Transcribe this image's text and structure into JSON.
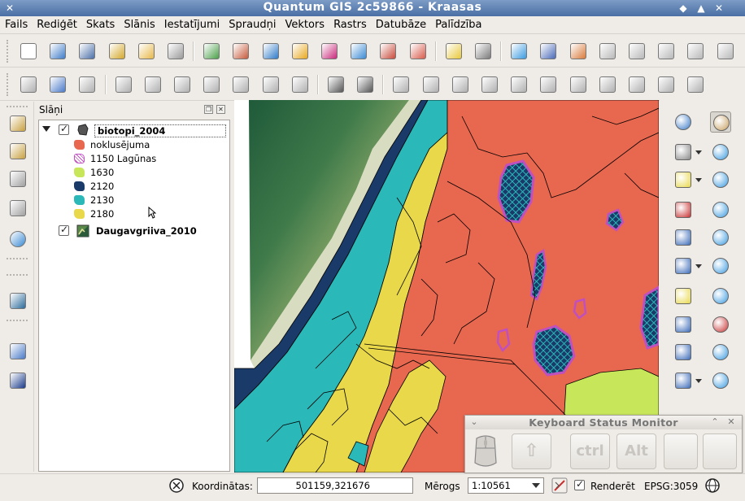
{
  "window": {
    "title": "Quantum GIS 2c59866 - Kraasas",
    "buttons": [
      "◆",
      "▲",
      "✕"
    ]
  },
  "menu": [
    "Fails",
    "Rediģēt",
    "Skats",
    "Slānis",
    "Iestatījumi",
    "Spraudņi",
    "Vektors",
    "Rastrs",
    "Datubāze",
    "Palīdzība"
  ],
  "toolbar1": [
    {
      "name": "new-project-icon",
      "color": "#ffffff"
    },
    {
      "name": "open-project-icon",
      "color": "#3e7cc8"
    },
    {
      "name": "save-project-icon",
      "color": "#4b6fa8"
    },
    {
      "name": "save-as-icon",
      "color": "#d4a82a"
    },
    {
      "name": "new-print-composer-icon",
      "color": "#e8b84a"
    },
    {
      "name": "print-icon",
      "color": "#9a9a9a"
    },
    {
      "name": "add-vector-layer-icon",
      "color": "#4aa048"
    },
    {
      "name": "add-raster-layer-icon",
      "color": "#c75a3a"
    },
    {
      "name": "add-postgis-layer-icon",
      "color": "#2f7ac8"
    },
    {
      "name": "add-spatialite-layer-icon",
      "color": "#e8a820"
    },
    {
      "name": "add-mssql-layer-icon",
      "color": "#c8287a"
    },
    {
      "name": "add-wms-layer-icon",
      "color": "#3a8ad4"
    },
    {
      "name": "add-wcs-layer-icon",
      "color": "#c84a3a"
    },
    {
      "name": "add-wfs-layer-icon",
      "color": "#d85a4a"
    },
    {
      "name": "new-shapefile-layer-icon",
      "color": "#e8c83a"
    },
    {
      "name": "remove-layer-icon",
      "color": "#7a7a7a"
    },
    {
      "name": "gps-icon",
      "color": "#3a9ae0"
    },
    {
      "name": "label-icon",
      "color": "#4a6ab8"
    },
    {
      "name": "style-manager-icon",
      "color": "#d87a3a"
    },
    {
      "name": "edit-label-icon",
      "color": "#b8b8b8"
    },
    {
      "name": "show-hide-labels-icon",
      "color": "#b8b8b8"
    },
    {
      "name": "pin-labels-icon",
      "color": "#b8b8b8"
    },
    {
      "name": "rotate-label-icon",
      "color": "#b8b8b8"
    },
    {
      "name": "change-label-icon",
      "color": "#b8b8b8"
    }
  ],
  "toolbar2": [
    {
      "name": "current-edits-icon",
      "color": "#b0b0b0"
    },
    {
      "name": "toggle-editing-icon",
      "color": "#4a7ac8"
    },
    {
      "name": "save-edits-icon",
      "color": "#b0b0b0"
    },
    {
      "name": "add-feature-icon",
      "color": "#b0b0b0"
    },
    {
      "name": "move-feature-icon",
      "color": "#b0b0b0"
    },
    {
      "name": "node-tool-icon",
      "color": "#b0b0b0"
    },
    {
      "name": "delete-selected-icon",
      "color": "#b0b0b0"
    },
    {
      "name": "cut-features-icon",
      "color": "#b0b0b0"
    },
    {
      "name": "copy-features-icon",
      "color": "#b0b0b0"
    },
    {
      "name": "paste-features-icon",
      "color": "#b0b0b0"
    },
    {
      "name": "undo-icon",
      "color": "#555555"
    },
    {
      "name": "redo-icon",
      "color": "#555555"
    },
    {
      "name": "simplify-feature-icon",
      "color": "#b0b0b0"
    },
    {
      "name": "add-ring-icon",
      "color": "#b0b0b0"
    },
    {
      "name": "add-part-icon",
      "color": "#b0b0b0"
    },
    {
      "name": "delete-ring-icon",
      "color": "#b0b0b0"
    },
    {
      "name": "delete-part-icon",
      "color": "#b0b0b0"
    },
    {
      "name": "reshape-features-icon",
      "color": "#b0b0b0"
    },
    {
      "name": "offset-curve-icon",
      "color": "#b0b0b0"
    },
    {
      "name": "split-features-icon",
      "color": "#b0b0b0"
    },
    {
      "name": "merge-features-icon",
      "color": "#b0b0b0"
    },
    {
      "name": "merge-attributes-icon",
      "color": "#b0b0b0"
    },
    {
      "name": "rotate-point-symbols-icon",
      "color": "#b0b0b0"
    }
  ],
  "left_toolbar": [
    {
      "name": "histogram-stretch-icon"
    },
    {
      "name": "local-histogram-stretch-icon"
    },
    {
      "name": "increase-brightness-icon"
    },
    {
      "name": "decrease-brightness-icon"
    },
    {
      "name": "globe-icon"
    },
    {
      "name": "database-icon"
    },
    {
      "name": "help-book-icon"
    },
    {
      "name": "whats-this-icon"
    }
  ],
  "layers_panel": {
    "title": "Slāņi",
    "layers": [
      {
        "name": "biotopi_2004",
        "checked": true,
        "expanded": true,
        "symbols": [
          {
            "label": "noklusējuma",
            "color": "#e8674f"
          },
          {
            "label": "1150 Lagūnas",
            "color": "#c050c0"
          },
          {
            "label": "1630",
            "color": "#c8e65a"
          },
          {
            "label": "2120",
            "color": "#1a3a6a"
          },
          {
            "label": "2130",
            "color": "#2ab8b8"
          },
          {
            "label": "2180",
            "color": "#e8d84a"
          }
        ]
      },
      {
        "name": "Daugavgriiva_2010",
        "checked": true
      }
    ]
  },
  "right_toolbar": [
    {
      "name": "identify-features-icon"
    },
    {
      "name": "pan-map-icon"
    },
    {
      "name": "action-gear-icon"
    },
    {
      "name": "pan-to-selection-icon"
    },
    {
      "name": "select-features-icon"
    },
    {
      "name": "zoom-in-icon"
    },
    {
      "name": "deselect-all-icon"
    },
    {
      "name": "zoom-out-icon"
    },
    {
      "name": "attribute-table-icon"
    },
    {
      "name": "zoom-full-icon"
    },
    {
      "name": "measure-line-icon"
    },
    {
      "name": "zoom-to-selection-icon"
    },
    {
      "name": "map-tips-icon"
    },
    {
      "name": "zoom-to-layer-icon"
    },
    {
      "name": "new-bookmark-icon"
    },
    {
      "name": "zoom-last-icon"
    },
    {
      "name": "show-bookmarks-icon"
    },
    {
      "name": "zoom-next-icon"
    },
    {
      "name": "text-annotation-icon"
    },
    {
      "name": "zoom-actual-size-icon"
    }
  ],
  "keyboard_monitor": {
    "title": "Keyboard Status Monitor",
    "keys": [
      "⇧",
      "ctrl",
      "Alt",
      "",
      ""
    ]
  },
  "statusbar": {
    "coord_label": "Koordinātas:",
    "coord_value": "501159,321676",
    "scale_label": "Mērogs",
    "scale_value": "1:10561",
    "render_label": "Renderēt",
    "crs": "EPSG:3059"
  },
  "map_colors": {
    "noklusejuma": "#e8674f",
    "lagunas": "#c050c0",
    "c1630": "#c8e65a",
    "c2120": "#1a3a6a",
    "c2130": "#2ab8b8",
    "c2180": "#e8d84a"
  }
}
